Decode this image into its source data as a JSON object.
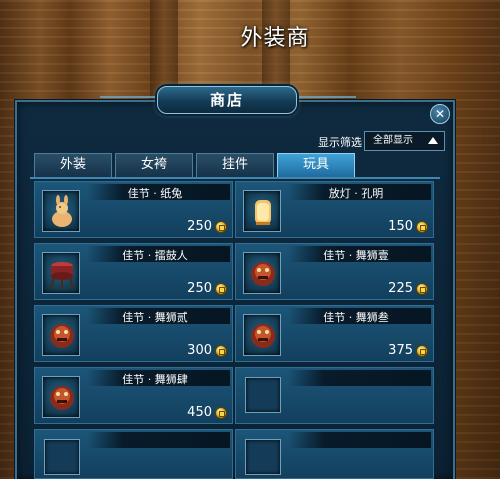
{
  "npc_title": "外装商",
  "window_title": "商店",
  "filter": {
    "label": "显示筛选",
    "selected": "全部显示"
  },
  "tabs": [
    {
      "label": "外装",
      "active": false
    },
    {
      "label": "女袴",
      "active": false
    },
    {
      "label": "挂件",
      "active": false
    },
    {
      "label": "玩具",
      "active": true
    }
  ],
  "items": [
    {
      "name": "佳节 · 纸兔",
      "price": "250",
      "icon": "paper-rabbit-icon"
    },
    {
      "name": "放灯 · 孔明",
      "price": "150",
      "icon": "kongming-lantern-icon"
    },
    {
      "name": "佳节 · 擂鼓人",
      "price": "250",
      "icon": "drummer-icon"
    },
    {
      "name": "佳节 · 舞狮壹",
      "price": "225",
      "icon": "lion-dance-icon"
    },
    {
      "name": "佳节 · 舞狮贰",
      "price": "300",
      "icon": "lion-dance-icon"
    },
    {
      "name": "佳节 · 舞狮叁",
      "price": "375",
      "icon": "lion-dance-icon"
    },
    {
      "name": "佳节 · 舞狮肆",
      "price": "450",
      "icon": "lion-dance-icon"
    }
  ],
  "currency_icon": "gold-coin-icon",
  "colors": {
    "active_tab": "#3fa3d8",
    "panel": "#0f2a3f",
    "card": "#1c5679"
  }
}
